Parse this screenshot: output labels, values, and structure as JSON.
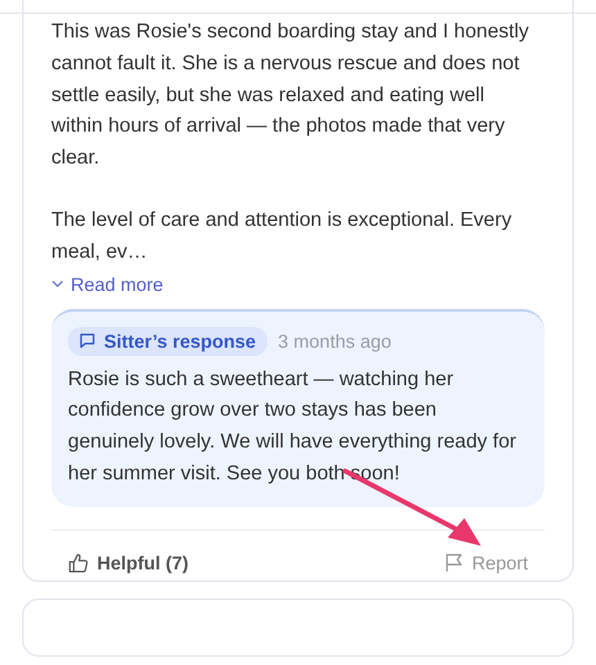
{
  "review": {
    "paragraphs": [
      "This was Rosie's second boarding stay and I honestly cannot fault it. She is a nervous rescue and does not settle easily, but she was relaxed and eating well within hours of arrival — the photos made that very clear.",
      "The level of care and attention is exceptional. Every meal, ev…"
    ],
    "read_more": "Read more",
    "response": {
      "badge": "Sitter’s response",
      "time": "3 months ago",
      "text": "Rosie is such a sweetheart — watching her confidence grow over two stays has been genuinely lovely. We will have everything ready for her summer visit. See you both soon!"
    },
    "helpful": "Helpful (7)",
    "report": "Report"
  },
  "annotation": {
    "kind": "arrow"
  }
}
